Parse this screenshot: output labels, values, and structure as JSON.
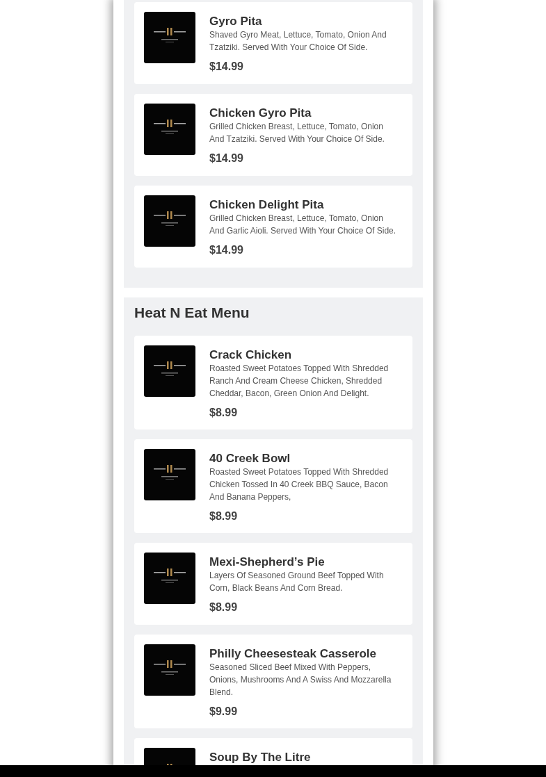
{
  "sections": [
    {
      "items": [
        {
          "name": "Gyro Pita",
          "description": "Shaved Gyro Meat, Lettuce, Tomato, Onion And Tzatziki. Served With Your Choice Of Side.",
          "price": "$14.99"
        },
        {
          "name": "Chicken Gyro Pita",
          "description": "Grilled Chicken Breast, Lettuce, Tomato, Onion And Tzatziki. Served With Your Choice Of Side.",
          "price": "$14.99"
        },
        {
          "name": "Chicken Delight Pita",
          "description": "Grilled Chicken Breast, Lettuce, Tomato, Onion And Garlic Aioli. Served With Your Choice Of Side.",
          "price": "$14.99"
        }
      ]
    },
    {
      "title": "Heat N Eat Menu",
      "items": [
        {
          "name": "Crack Chicken",
          "description": "Roasted Sweet Potatoes Topped With Shredded Ranch And Cream Cheese Chicken, Shredded Cheddar, Bacon, Green Onion And Delight.",
          "price": "$8.99"
        },
        {
          "name": "40 Creek Bowl",
          "description": "Roasted Sweet Potatoes Topped With Shredded Chicken Tossed In 40 Creek BBQ Sauce, Bacon And Banana Peppers,",
          "price": "$8.99"
        },
        {
          "name": "Mexi-Shepherd’s Pie",
          "description": "Layers Of Seasoned Ground Beef Topped With Corn, Black Beans And Corn Bread.",
          "price": "$8.99"
        },
        {
          "name": "Philly Cheesesteak Casserole",
          "description": "Seasoned Sliced Beef Mixed With Peppers, Onions, Mushrooms And A Swiss And Mozzarella Blend.",
          "price": "$9.99"
        },
        {
          "name": "Soup By The Litre"
        }
      ]
    }
  ]
}
